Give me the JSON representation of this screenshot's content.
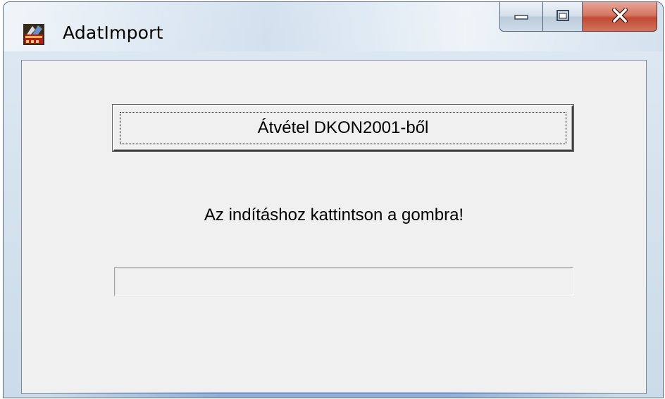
{
  "window": {
    "title": "AdatImport",
    "icon": "app-icon"
  },
  "caption_buttons": {
    "minimize_icon": "minimize-icon",
    "maximize_icon": "maximize-icon",
    "close_icon": "close-icon"
  },
  "main": {
    "import_button_label": "Átvétel DKON2001-ből",
    "status_text": "Az indításhoz kattintson a gombra!",
    "progress": 0
  },
  "colors": {
    "close_button": "#c24a33",
    "client_background": "#f0f0f0"
  }
}
